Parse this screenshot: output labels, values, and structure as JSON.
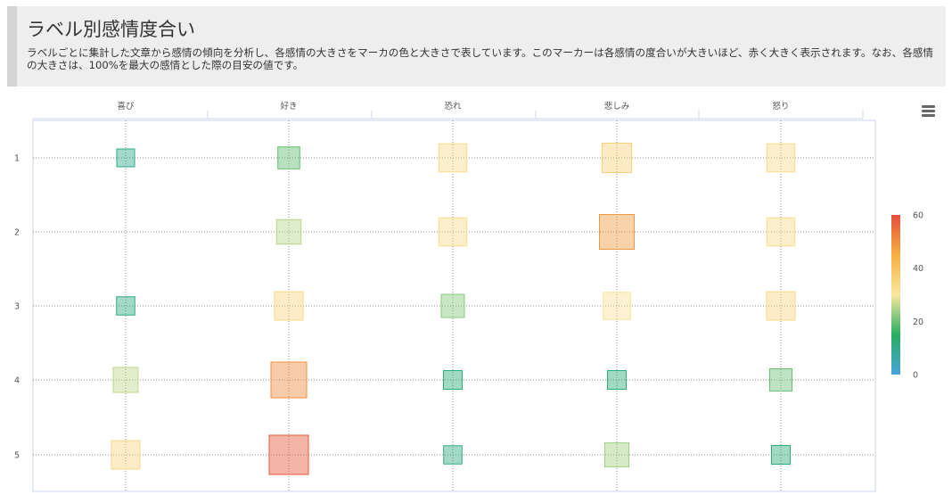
{
  "header": {
    "title": "ラベル別感情度合い",
    "description": "ラベルごとに集計した文章から感情の傾向を分析し、各感情の大きさをマーカの色と大きさで表しています。このマーカーは各感情の度合いが大きいほど、赤く大きく表示されます。なお、各感情の大きさは、100%を最大の感情とした際の目安の値です。"
  },
  "menu": {
    "icon": "hamburger-menu-icon"
  },
  "chart_data": {
    "type": "heatmap",
    "title": "ラベル別感情度合い",
    "categories": [
      "喜び",
      "好き",
      "恐れ",
      "悲しみ",
      "怒り"
    ],
    "rows": [
      "1",
      "2",
      "3",
      "4",
      "5"
    ],
    "values": [
      [
        10,
        19,
        33,
        36,
        33
      ],
      [
        null,
        25,
        33,
        48,
        33
      ],
      [
        11,
        34,
        22,
        31,
        34
      ],
      [
        26,
        50,
        12,
        12,
        20
      ],
      [
        34,
        58,
        11,
        24,
        12
      ]
    ],
    "colorScale": {
      "min": 0,
      "max": 60,
      "ticks": [
        0,
        20,
        40,
        60
      ],
      "stops": [
        "#4aa3df",
        "#27ae60",
        "#f9e79f",
        "#f5b041",
        "#e74c3c"
      ]
    },
    "grid": true,
    "legend": "right"
  }
}
